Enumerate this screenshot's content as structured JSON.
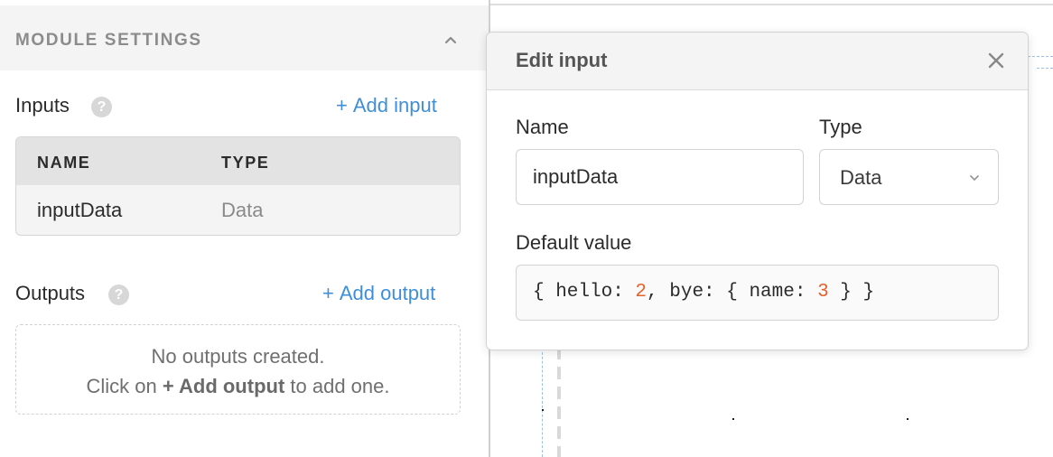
{
  "module_settings": {
    "title": "MODULE SETTINGS",
    "collapse_icon": "chevron-up-icon"
  },
  "inputs": {
    "label": "Inputs",
    "help_icon": "?",
    "add_plus": "+",
    "add_label": "Add input",
    "columns": [
      "NAME",
      "TYPE"
    ],
    "rows": [
      {
        "name": "inputData",
        "type": "Data"
      }
    ]
  },
  "outputs": {
    "label": "Outputs",
    "help_icon": "?",
    "add_plus": "+",
    "add_label": "Add output",
    "empty_line1": "No outputs created.",
    "empty_line2_before": "Click on",
    "empty_line2_bold": "+ Add output",
    "empty_line2_after": "to add one."
  },
  "edit_modal": {
    "title": "Edit input",
    "close_icon": "close-icon",
    "name_label": "Name",
    "name_value": "inputData",
    "type_label": "Type",
    "type_value": "Data",
    "default_label": "Default value",
    "default_value": {
      "p1": "{ hello: ",
      "n1": "2",
      "p2": ", bye: { name: ",
      "n2": "3",
      "p3": " } }"
    }
  },
  "colors": {
    "accent_link": "#3f8fd8",
    "code_number": "#e3622d",
    "header_bg": "#f4f4f4"
  }
}
